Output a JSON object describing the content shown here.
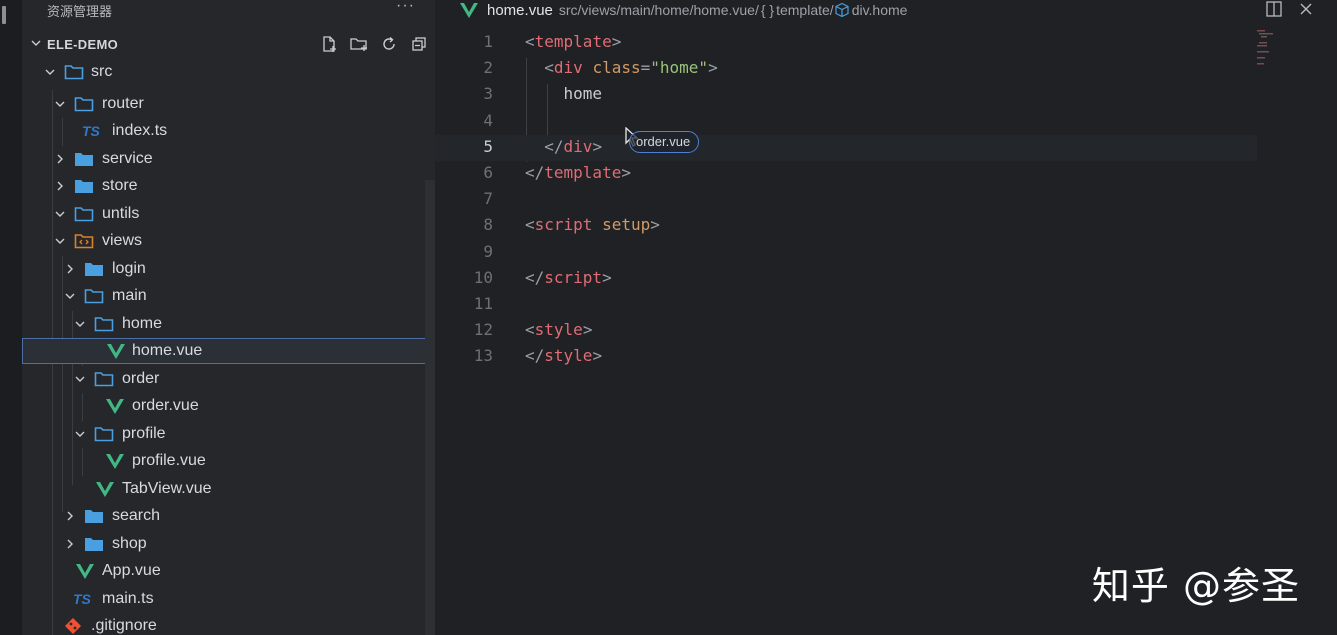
{
  "sidebar": {
    "title": "资源管理器",
    "more": "···",
    "project": "ELE-DEMO",
    "items": [
      {
        "label": "src",
        "icon": "folder-open-icon"
      },
      {
        "label": "router",
        "icon": "folder-open-icon"
      },
      {
        "label": "index.ts",
        "icon": "typescript-icon",
        "badge": "TS"
      },
      {
        "label": "service",
        "icon": "folder-icon"
      },
      {
        "label": "store",
        "icon": "folder-icon"
      },
      {
        "label": "untils",
        "icon": "folder-open-icon"
      },
      {
        "label": "views",
        "icon": "views-folder-icon"
      },
      {
        "label": "login",
        "icon": "folder-icon"
      },
      {
        "label": "main",
        "icon": "folder-open-icon"
      },
      {
        "label": "home",
        "icon": "folder-open-icon"
      },
      {
        "label": "home.vue",
        "icon": "vue-icon"
      },
      {
        "label": "order",
        "icon": "folder-open-icon"
      },
      {
        "label": "order.vue",
        "icon": "vue-icon"
      },
      {
        "label": "profile",
        "icon": "folder-open-icon"
      },
      {
        "label": "profile.vue",
        "icon": "vue-icon"
      },
      {
        "label": "TabView.vue",
        "icon": "vue-icon"
      },
      {
        "label": "search",
        "icon": "folder-icon"
      },
      {
        "label": "shop",
        "icon": "folder-icon"
      },
      {
        "label": "App.vue",
        "icon": "vue-icon"
      },
      {
        "label": "main.ts",
        "icon": "typescript-icon",
        "badge": "TS"
      },
      {
        "label": ".gitignore",
        "icon": "git-icon"
      }
    ]
  },
  "editor": {
    "breadcrumb": {
      "file": "home.vue",
      "path": "src/views/main/home/home.vue/",
      "brace": "{ }",
      "segment": "template/",
      "element": "div.home"
    },
    "current_line": 5,
    "lines": [
      {
        "n": "1",
        "parts": [
          [
            "<",
            "b"
          ],
          [
            "template",
            "tag"
          ],
          [
            ">",
            "b"
          ]
        ]
      },
      {
        "n": "2",
        "parts": [
          [
            "  ",
            "text"
          ],
          [
            "<",
            "b"
          ],
          [
            "div",
            "tag"
          ],
          [
            " ",
            "text"
          ],
          [
            "class",
            "attr"
          ],
          [
            "=",
            "b"
          ],
          [
            "\"home\"",
            "str"
          ],
          [
            ">",
            "b"
          ]
        ]
      },
      {
        "n": "3",
        "parts": [
          [
            "    home",
            "text"
          ]
        ]
      },
      {
        "n": "4",
        "parts": []
      },
      {
        "n": "5",
        "parts": [
          [
            "  ",
            "text"
          ],
          [
            "</",
            "b"
          ],
          [
            "div",
            "tag"
          ],
          [
            ">",
            "b"
          ]
        ]
      },
      {
        "n": "6",
        "parts": [
          [
            "</",
            "b"
          ],
          [
            "template",
            "tag"
          ],
          [
            ">",
            "b"
          ]
        ]
      },
      {
        "n": "7",
        "parts": []
      },
      {
        "n": "8",
        "parts": [
          [
            "<",
            "b"
          ],
          [
            "script",
            "tag"
          ],
          [
            " ",
            "text"
          ],
          [
            "setup",
            "attr"
          ],
          [
            ">",
            "b"
          ]
        ]
      },
      {
        "n": "9",
        "parts": []
      },
      {
        "n": "10",
        "parts": [
          [
            "</",
            "b"
          ],
          [
            "script",
            "tag"
          ],
          [
            ">",
            "b"
          ]
        ]
      },
      {
        "n": "11",
        "parts": []
      },
      {
        "n": "12",
        "parts": [
          [
            "<",
            "b"
          ],
          [
            "style",
            "tag"
          ],
          [
            ">",
            "b"
          ]
        ]
      },
      {
        "n": "13",
        "parts": [
          [
            "</",
            "b"
          ],
          [
            "style",
            "tag"
          ],
          [
            ">",
            "b"
          ]
        ]
      }
    ],
    "drag_label": "order.vue"
  },
  "watermark": "知乎 @参圣",
  "colors": {
    "vue": "#41b883",
    "ts": "#3178c6",
    "folder": "#4a9fe0",
    "tag": "#e06c75",
    "attr": "#d19a66",
    "string": "#98c379",
    "git": "#f05133",
    "selection_border": "#4d6fa6"
  }
}
